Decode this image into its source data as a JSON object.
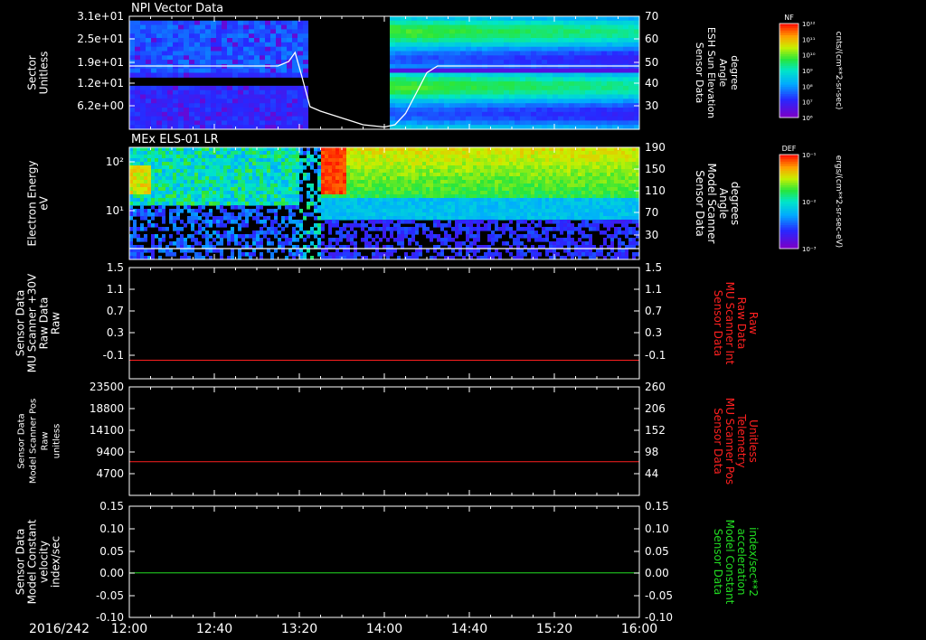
{
  "chart_data": [
    {
      "type": "heatmap",
      "title": "NPI Vector Data",
      "ylabel_left": [
        "Sector",
        "Unitless"
      ],
      "yticks_left": [
        "3.1e+01",
        "2.5e+01",
        "1.9e+01",
        "1.2e+01",
        "6.2e+00"
      ],
      "ylabel_right": [
        "Sensor Data",
        "ESH Sun Elevation",
        "Angle",
        "degree"
      ],
      "yticks_right": [
        "70",
        "60",
        "50",
        "40",
        "30"
      ],
      "ylim_right": [
        20,
        70
      ],
      "data_gap": [
        "13:23",
        "14:02"
      ],
      "overlay_line": {
        "color": "#ffffff",
        "x": [
          "12:00",
          "13:10",
          "13:15",
          "13:18",
          "13:21",
          "13:25",
          "13:30",
          "13:40",
          "13:50",
          "14:00",
          "14:05",
          "14:10",
          "14:15",
          "14:20",
          "14:25",
          "16:00"
        ],
        "y": [
          48,
          48,
          50,
          54,
          44,
          30,
          28,
          25,
          22,
          21,
          22,
          27,
          36,
          45,
          48,
          48
        ]
      },
      "colorbar": {
        "label": "NF",
        "units": "cnts/(cm**2-sr-sec)",
        "ticks": [
          "10¹²",
          "10¹¹",
          "10¹⁰",
          "10⁹",
          "10⁸",
          "10⁷",
          "10⁶"
        ]
      }
    },
    {
      "type": "heatmap",
      "title": "MEx ELS-01 LR",
      "ylabel_left": [
        "Electron Energy",
        "eV"
      ],
      "yticks_left": [
        "10²",
        "10¹"
      ],
      "yscale": "log",
      "ylabel_right": [
        "Sensor Data",
        "Model Scanner",
        "Angle",
        "degrees"
      ],
      "yticks_right": [
        "190",
        "150",
        "110",
        "70",
        "30"
      ],
      "ylim_right": [
        0,
        190
      ],
      "overlay_line": {
        "color": "#ffffff",
        "x": [
          "12:00",
          "16:00"
        ],
        "y": [
          0,
          0
        ]
      },
      "colorbar": {
        "label": "DEF",
        "units": "ergs/(cm**2-sr-sec-eV)",
        "ticks": [
          "10⁻¹",
          "10⁻²",
          "10⁻³"
        ]
      }
    },
    {
      "type": "line",
      "ylabel_left": [
        "Sensor Data",
        "MU Scanner +30V",
        "Raw Data",
        "Raw"
      ],
      "yticks_left": [
        "1.5",
        "1.1",
        "0.7",
        "0.3",
        "-0.1"
      ],
      "ylim": [
        -0.3,
        1.5
      ],
      "ylabel_right": [
        "Sensor Data",
        "MU Scanner Int",
        "Raw Data",
        "Raw"
      ],
      "ylabel_right_color": "#ff2020",
      "yticks_right": [
        "1.5",
        "1.1",
        "0.7",
        "0.3",
        "-0.1"
      ],
      "series": [
        {
          "color": "#ff2020",
          "x": [
            "12:00",
            "16:00"
          ],
          "y": [
            0.0,
            0.0
          ]
        }
      ]
    },
    {
      "type": "line",
      "ylabel_left": [
        "Sensor Data",
        "Model Scanner Pos",
        "Raw",
        "unitless"
      ],
      "yticks_left": [
        "23500",
        "18800",
        "14100",
        "9400",
        "4700"
      ],
      "ylim": [
        0,
        23500
      ],
      "ylabel_right": [
        "Sensor Data",
        "MU Scanner Pos",
        "Telemetry",
        "Unitless"
      ],
      "ylabel_right_color": "#ff2020",
      "yticks_right": [
        "260",
        "206",
        "152",
        "98",
        "44"
      ],
      "series": [
        {
          "color": "#ff2020",
          "x": [
            "12:00",
            "16:00"
          ],
          "y": [
            7300,
            7300
          ]
        }
      ]
    },
    {
      "type": "line",
      "ylabel_left": [
        "Sensor Data",
        "Model Constant",
        "velocity",
        "index/sec"
      ],
      "yticks_left": [
        "0.15",
        "0.10",
        "0.05",
        "0.00",
        "-0.05",
        "-0.10"
      ],
      "ylim": [
        -0.1,
        0.15
      ],
      "ylabel_right": [
        "Sensor Data",
        "Model Constant",
        "acceleration",
        "index/sec**2"
      ],
      "ylabel_right_color": "#22dd22",
      "yticks_right": [
        "0.15",
        "0.10",
        "0.05",
        "0.00",
        "-0.05",
        "-0.10"
      ],
      "series": [
        {
          "color": "#22dd22",
          "x": [
            "12:00",
            "16:00"
          ],
          "y": [
            0.0,
            0.0
          ]
        }
      ]
    }
  ],
  "x_axis": {
    "date": "2016/242",
    "ticks": [
      "12:00",
      "12:40",
      "13:20",
      "14:00",
      "14:40",
      "15:20",
      "16:00"
    ],
    "range": [
      "12:00",
      "16:00"
    ]
  }
}
